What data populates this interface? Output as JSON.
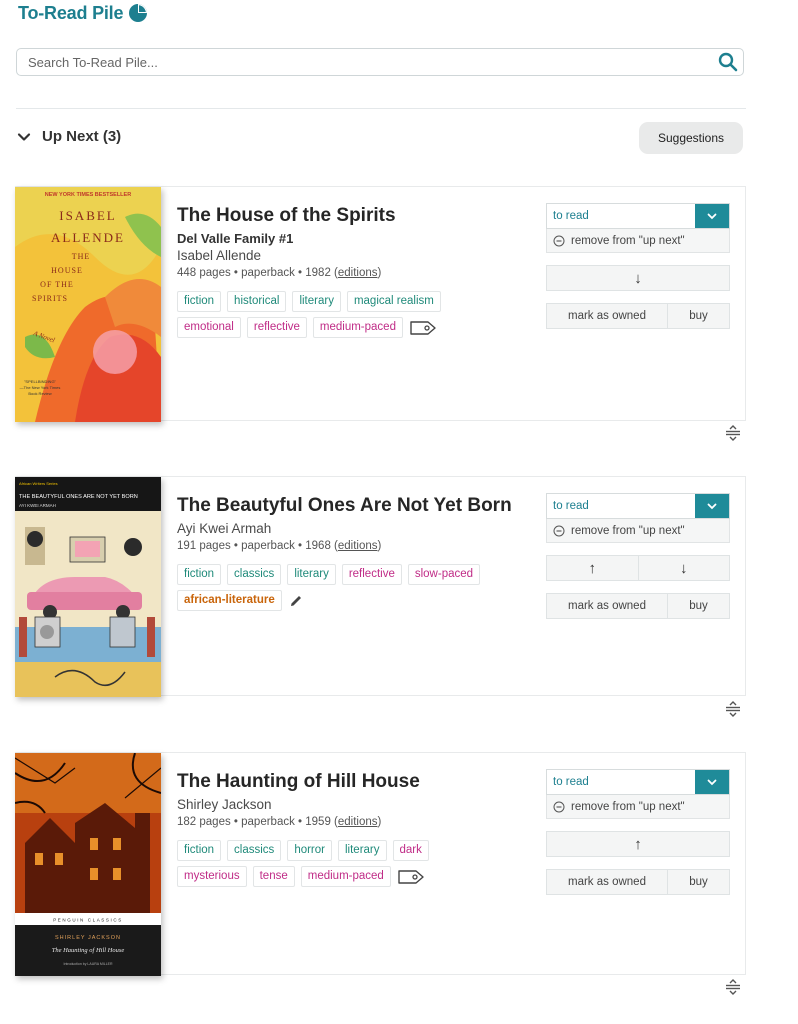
{
  "header": {
    "title": "To-Read Pile",
    "icon": "pie-chart-icon",
    "accent": "#1d7f8f"
  },
  "search": {
    "placeholder": "Search To-Read Pile...",
    "value": "",
    "icon": "search-icon"
  },
  "section": {
    "title": "Up Next (3)",
    "suggestions_label": "Suggestions"
  },
  "books": [
    {
      "title": "The House of the Spirits",
      "series": "Del Valle Family #1",
      "author": "Isabel Allende",
      "meta_prefix": "448 pages • paperback • 1982 (",
      "editions_label": "editions",
      "meta_suffix": ")",
      "cover": {
        "banner": "NEW YORK TIMES BESTSELLER",
        "author_line1": "ISABEL",
        "author_line2": "ALLENDE",
        "title_line1": "THE",
        "title_line2": "HOUSE",
        "title_line3": "OF THE",
        "title_line4": "SPIRITS",
        "subtitle": "A Novel",
        "blurb_line1": "\"SPELLBINDING\"",
        "blurb_line2": "—The New York Times",
        "blurb_line3": "Book Review"
      },
      "genre_tags": [
        "fiction",
        "historical",
        "literary",
        "magical realism"
      ],
      "mood_tags": [
        "emotional",
        "reflective",
        "medium-paced"
      ],
      "status": "to read",
      "remove_label": "remove from \"up next\"",
      "move_down": "↓",
      "owned_label": "mark as owned",
      "buy_label": "buy"
    },
    {
      "title": "The Beautyful Ones Are Not Yet Born",
      "author": "Ayi Kwei Armah",
      "meta_prefix": "191 pages • paperback • 1968 (",
      "editions_label": "editions",
      "meta_suffix": ")",
      "cover": {
        "series": "African Writers Series",
        "title": "THE BEAUTYFUL ONES ARE NOT YET BORN",
        "author": "AYI KWEI ARMAH"
      },
      "genre_tags": [
        "fiction",
        "classics",
        "literary"
      ],
      "mood_tags": [
        "reflective",
        "slow-paced"
      ],
      "custom_tags": [
        "african-literature"
      ],
      "status": "to read",
      "remove_label": "remove from \"up next\"",
      "move_up": "↑",
      "move_down": "↓",
      "owned_label": "mark as owned",
      "buy_label": "buy"
    },
    {
      "title": "The Haunting of Hill House",
      "author": "Shirley Jackson",
      "meta_prefix": "182 pages • paperback • 1959 (",
      "editions_label": "editions",
      "meta_suffix": ")",
      "cover": {
        "publisher": "PENGUIN CLASSICS",
        "author": "SHIRLEY JACKSON",
        "title": "The Haunting of Hill House",
        "intro": "Introduction by LAURA MILLER"
      },
      "genre_tags": [
        "fiction",
        "classics",
        "horror",
        "literary"
      ],
      "mood_tags": [
        "dark",
        "mysterious",
        "tense",
        "medium-paced"
      ],
      "status": "to read",
      "remove_label": "remove from \"up next\"",
      "move_up": "↑",
      "owned_label": "mark as owned",
      "buy_label": "buy"
    }
  ],
  "colors": {
    "genre_tag": "#1f8a7a",
    "mood_tag": "#c02c87",
    "custom_tag": "#c9650b",
    "status_dropdown": "#1f8b99"
  }
}
